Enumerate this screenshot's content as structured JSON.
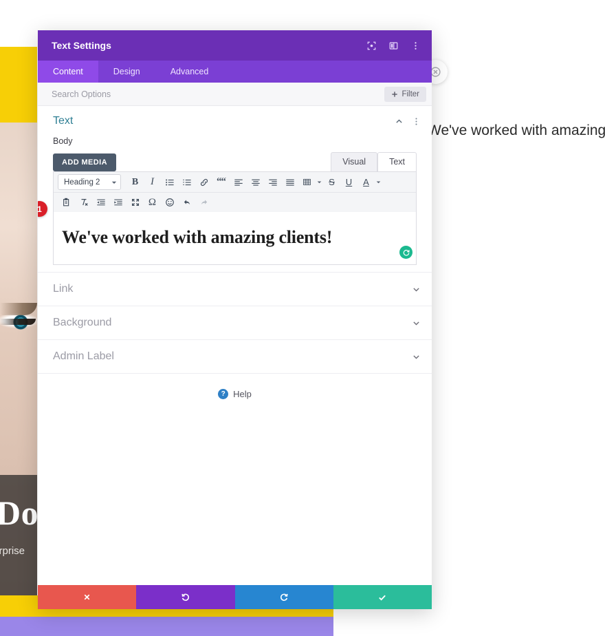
{
  "background_page": {
    "heading_right": "We've worked with amazing",
    "hero_heading_partial": "Do",
    "hero_sub_partial": "terprise",
    "close_icon": "close-circle-icon",
    "colors": {
      "yellow": "#f7cf06",
      "purple_band": "#9a86e8"
    }
  },
  "modal": {
    "title": "Text Settings",
    "header_icons": [
      {
        "name": "focus-module-icon"
      },
      {
        "name": "panel-layout-icon"
      },
      {
        "name": "more-vertical-icon"
      }
    ],
    "tabs": [
      {
        "label": "Content",
        "active": true
      },
      {
        "label": "Design",
        "active": false
      },
      {
        "label": "Advanced",
        "active": false
      }
    ],
    "search": {
      "placeholder": "Search Options",
      "value": ""
    },
    "filter_button": {
      "label": "Filter",
      "icon": "plus-icon"
    },
    "section": {
      "title": "Text",
      "collapse_icon": "chevron-up-icon",
      "menu_icon": "more-vertical-icon"
    },
    "body_field": {
      "label": "Body",
      "add_media_label": "ADD MEDIA",
      "editor_tabs": [
        {
          "label": "Visual",
          "active": false
        },
        {
          "label": "Text",
          "active": true
        }
      ],
      "format_select": {
        "value": "Heading 2",
        "icon": "caret-down-icon"
      },
      "toolbar_row1": [
        {
          "name": "bold-icon",
          "glyph": "B"
        },
        {
          "name": "italic-icon",
          "glyph": "I"
        },
        {
          "name": "bullet-list-icon"
        },
        {
          "name": "numbered-list-icon"
        },
        {
          "name": "link-icon"
        },
        {
          "name": "blockquote-icon",
          "glyph": "“"
        },
        {
          "name": "align-left-icon"
        },
        {
          "name": "align-center-icon"
        },
        {
          "name": "align-right-icon"
        },
        {
          "name": "align-justify-icon"
        },
        {
          "name": "table-icon"
        },
        {
          "name": "strikethrough-icon",
          "glyph": "S"
        },
        {
          "name": "underline-icon",
          "glyph": "U"
        },
        {
          "name": "text-color-icon",
          "glyph": "A"
        }
      ],
      "toolbar_row2": [
        {
          "name": "paste-as-text-icon"
        },
        {
          "name": "clear-formatting-icon"
        },
        {
          "name": "outdent-icon"
        },
        {
          "name": "indent-icon"
        },
        {
          "name": "fullscreen-icon"
        },
        {
          "name": "special-character-icon",
          "glyph": "Ω"
        },
        {
          "name": "emoji-icon"
        },
        {
          "name": "undo-icon"
        },
        {
          "name": "redo-icon"
        }
      ],
      "content_text": "We've worked with amazing clients!",
      "step_badge": "1",
      "reset_icon": "reset-circle-icon"
    },
    "accordions": [
      {
        "label": "Link",
        "icon": "chevron-down-icon"
      },
      {
        "label": "Background",
        "icon": "chevron-down-icon"
      },
      {
        "label": "Admin Label",
        "icon": "chevron-down-icon"
      }
    ],
    "help": {
      "label": "Help",
      "icon": "question-circle-icon"
    },
    "footer_buttons": [
      {
        "name": "cancel-button",
        "icon": "x-icon",
        "color": "#e8574e"
      },
      {
        "name": "undo-button",
        "icon": "undo-icon",
        "color": "#7b2fc9"
      },
      {
        "name": "redo-button",
        "icon": "redo-icon",
        "color": "#2786d1"
      },
      {
        "name": "save-button",
        "icon": "check-icon",
        "color": "#2bbd9b"
      }
    ]
  }
}
